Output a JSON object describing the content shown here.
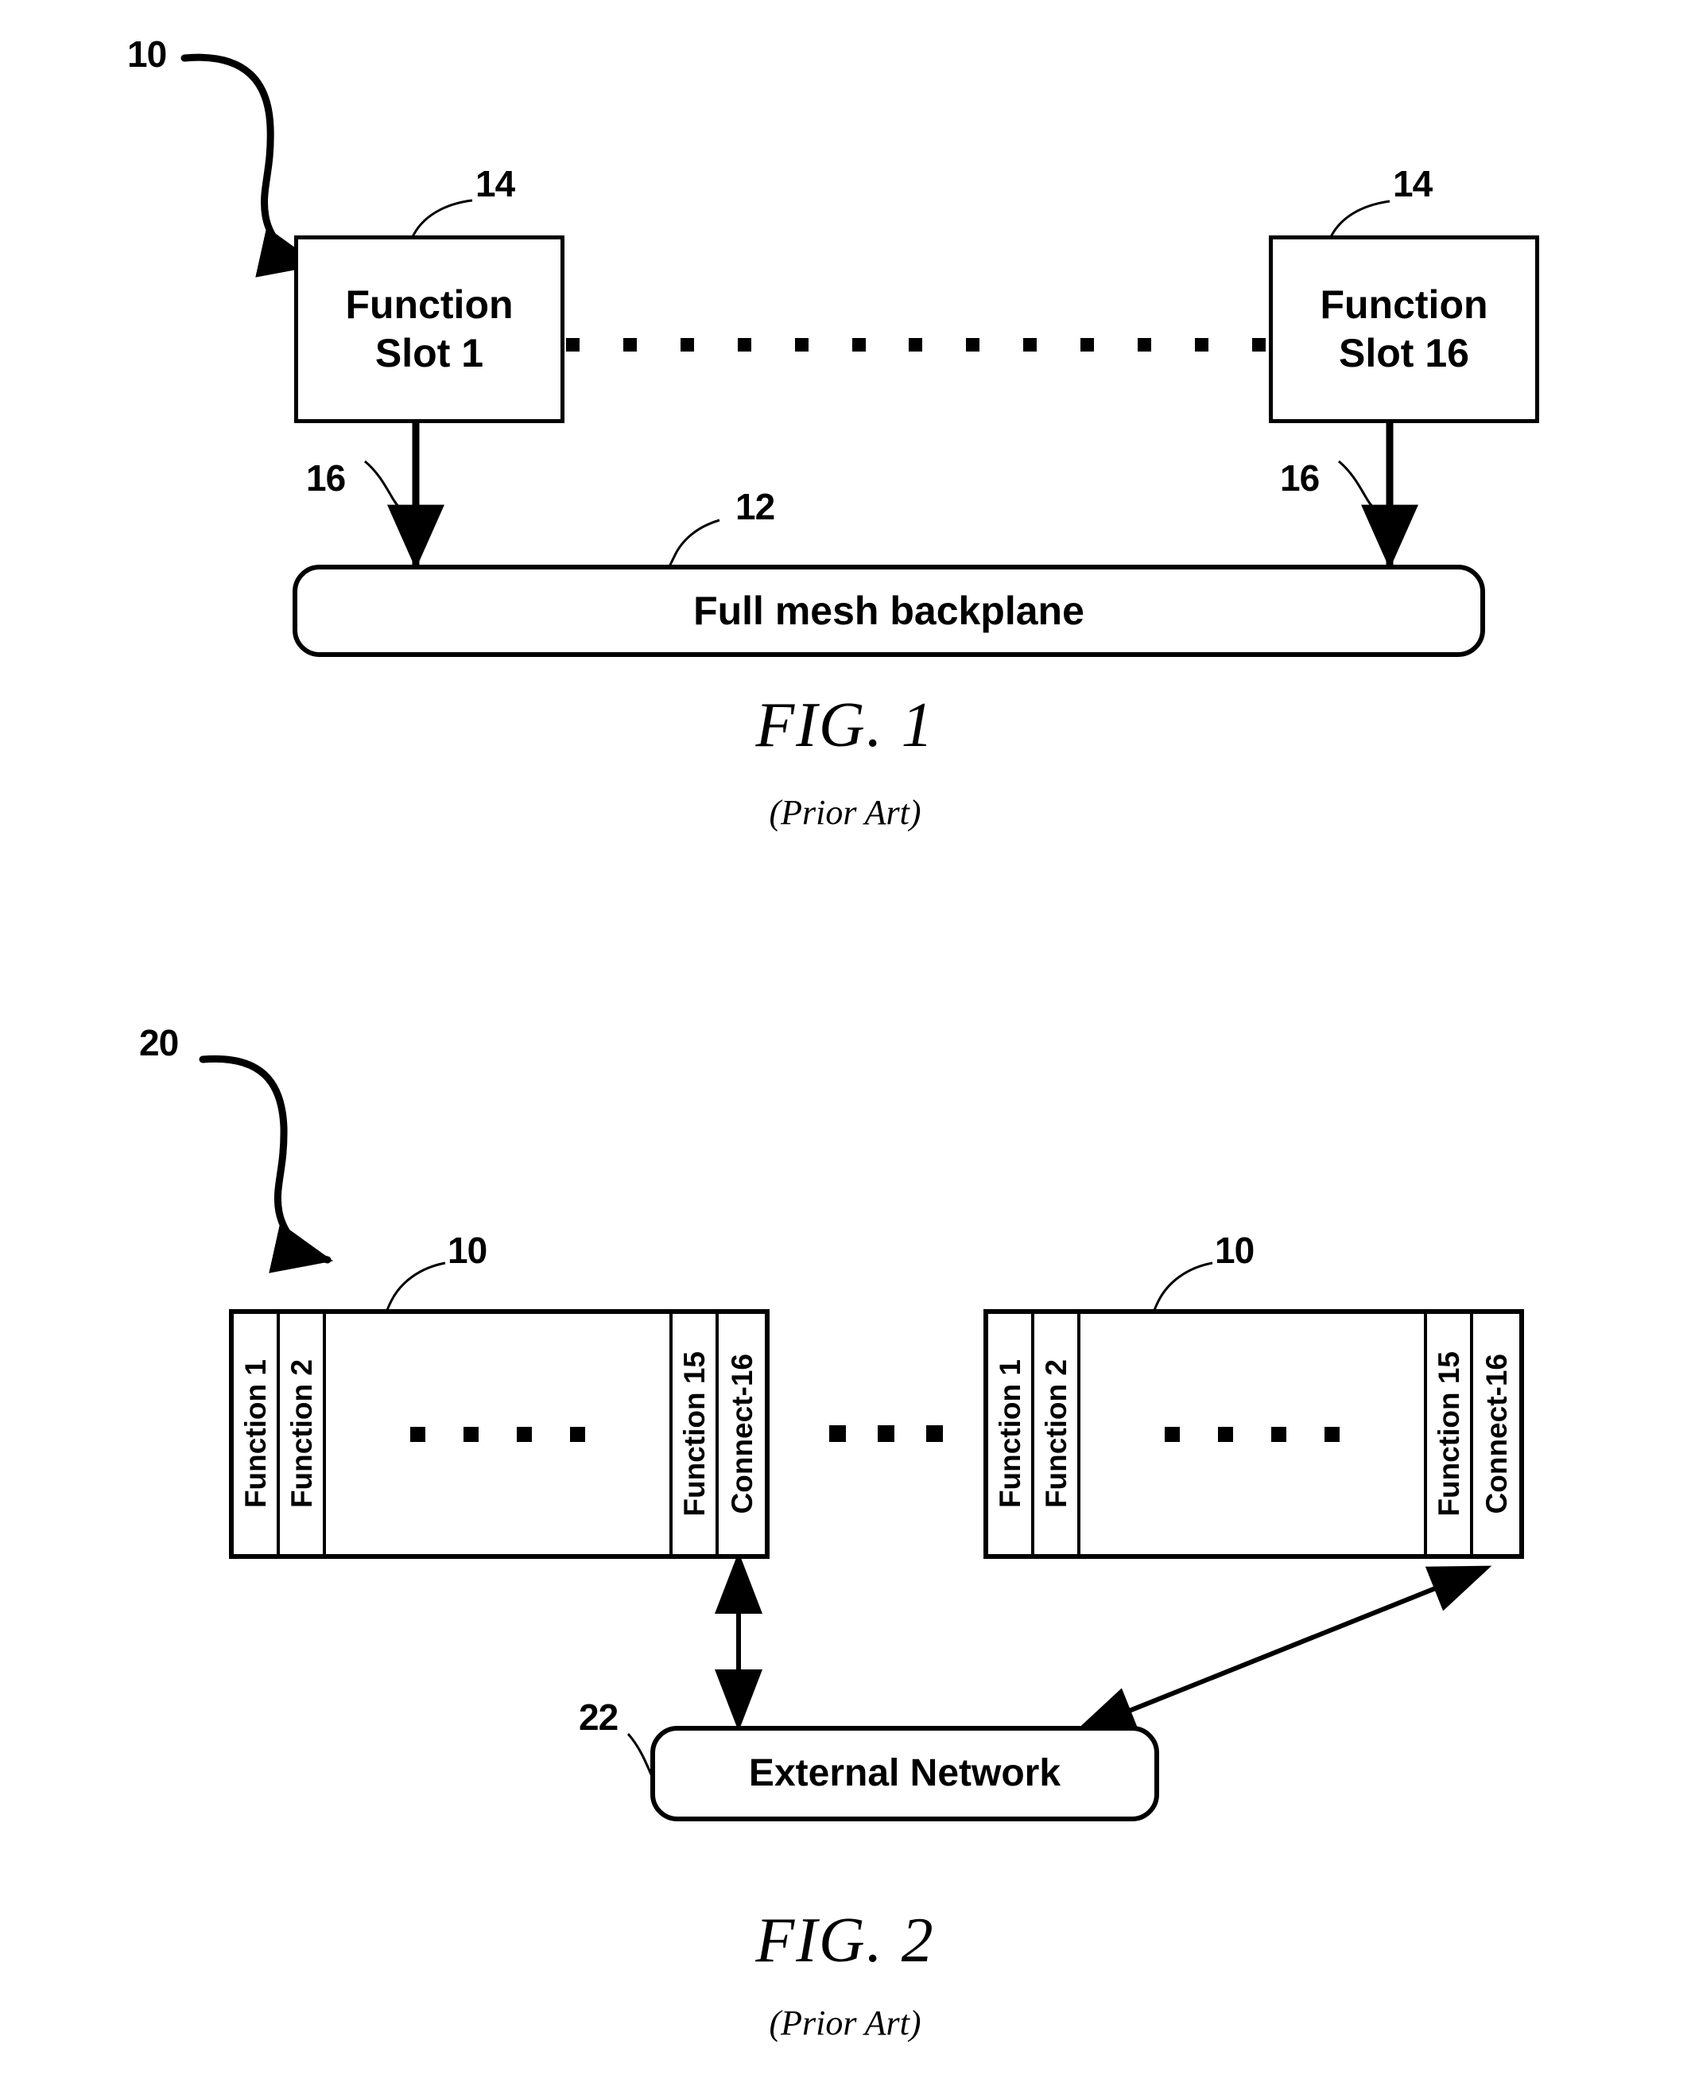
{
  "figure1": {
    "ref_system": "10",
    "ref_slot_left": "14",
    "ref_slot_right": "14",
    "ref_link_left": "16",
    "ref_link_right": "16",
    "ref_backplane": "12",
    "slot_left": {
      "line1": "Function",
      "line2": "Slot 1"
    },
    "slot_right": {
      "line1": "Function",
      "line2": "Slot 16"
    },
    "backplane_label": "Full mesh backplane",
    "caption": "FIG. 1",
    "caption_sub": "(Prior Art)",
    "connector_dot_count": 13
  },
  "figure2": {
    "ref_system": "20",
    "ref_chassis_left": "10",
    "ref_chassis_right": "10",
    "ref_external_network": "22",
    "chassis_left": {
      "cells": [
        "Function 1",
        "Function 2",
        "Function 15",
        "Connect-16"
      ],
      "inner_dot_count": 4
    },
    "chassis_right": {
      "cells": [
        "Function 1",
        "Function 2",
        "Function 15",
        "Connect-16"
      ],
      "inner_dot_count": 4
    },
    "between_chassis_dot_count": 3,
    "external_network_label": "External Network",
    "caption": "FIG. 2",
    "caption_sub": "(Prior Art)"
  },
  "colors": {
    "ink": "#000000",
    "paper": "#ffffff"
  }
}
